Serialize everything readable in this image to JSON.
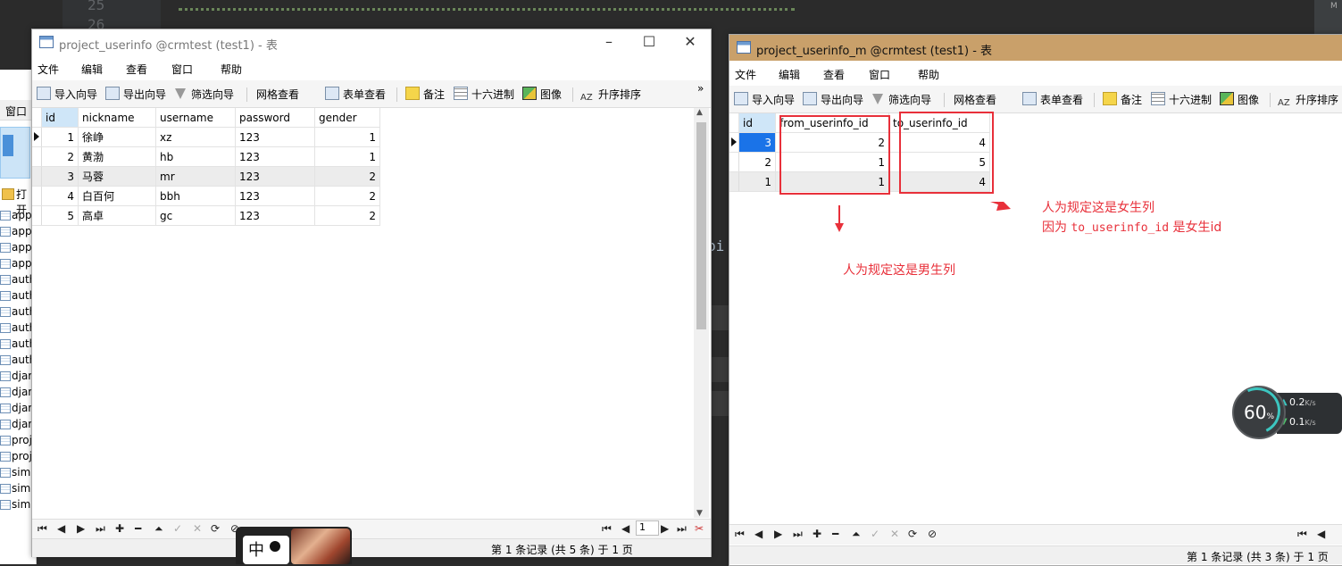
{
  "editor": {
    "line_numbers": [
      "25",
      "26"
    ],
    "fragment": "bi",
    "right_label": "M"
  },
  "object_panel": {
    "menu_label": "窗口",
    "open_label": "打开",
    "items": [
      "app",
      "app",
      "app",
      "app",
      "auth",
      "auth",
      "auth",
      "auth",
      "auth",
      "auth",
      "djar",
      "djar",
      "djar",
      "djar",
      "proj",
      "proj",
      "simp",
      "simp",
      "simp"
    ]
  },
  "menu": [
    "文件",
    "编辑",
    "查看",
    "窗口",
    "帮助"
  ],
  "toolbar": {
    "import": "导入向导",
    "export": "导出向导",
    "filter": "筛选向导",
    "grid_view": "网格查看",
    "form_view": "表单查看",
    "memo": "备注",
    "hex": "十六进制",
    "image": "图像",
    "sort": "升序排序",
    "sort_icon": "AZ",
    "more": "»"
  },
  "win1": {
    "title": "project_userinfo @crmtest (test1) - 表",
    "columns": [
      "id",
      "nickname",
      "username",
      "password",
      "gender"
    ],
    "rows": [
      [
        "1",
        "徐峥",
        "xz",
        "123",
        "1"
      ],
      [
        "2",
        "黄渤",
        "hb",
        "123",
        "1"
      ],
      [
        "3",
        "马蓉",
        "mr",
        "123",
        "2"
      ],
      [
        "4",
        "白百何",
        "bbh",
        "123",
        "2"
      ],
      [
        "5",
        "高卓",
        "gc",
        "123",
        "2"
      ]
    ],
    "page_value": "1",
    "status": "第 1 条记录 (共 5 条) 于 1 页"
  },
  "win2": {
    "title": "project_userinfo_m @crmtest (test1) - 表",
    "columns": [
      "id",
      "from_userinfo_id",
      "to_userinfo_id"
    ],
    "rows": [
      [
        "3",
        "2",
        "4"
      ],
      [
        "2",
        "1",
        "5"
      ],
      [
        "1",
        "1",
        "4"
      ]
    ],
    "status": "第 1 条记录 (共 3 条) 于 1 页"
  },
  "annotations": {
    "male_column": "人为规定这是男生列",
    "female_column": "人为规定这是女生列",
    "female_reason_prefix": "因为 ",
    "female_reason_code": "to_userinfo_id",
    "female_reason_suffix": " 是女生id",
    "color": "#e8303a"
  },
  "network": {
    "percent": "60",
    "percent_unit": "%",
    "up": "0.2",
    "down": "0.1",
    "unit": "K/s"
  },
  "ime": {
    "label": "中"
  }
}
